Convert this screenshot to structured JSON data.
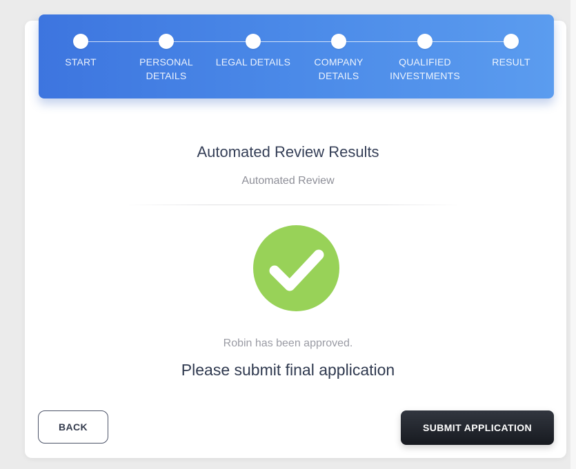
{
  "wizard": {
    "steps": [
      {
        "label": "START"
      },
      {
        "label": "PERSONAL\nDETAILS"
      },
      {
        "label": "LEGAL DETAILS"
      },
      {
        "label": "COMPANY\nDETAILS"
      },
      {
        "label": "QUALIFIED\nINVESTMENTS"
      },
      {
        "label": "RESULT"
      }
    ]
  },
  "review": {
    "title": "Automated Review Results",
    "subtitle": "Automated Review",
    "status_text": "Robin has been approved.",
    "cta_text": "Please submit final application"
  },
  "actions": {
    "back_label": "BACK",
    "submit_label": "SUBMIT APPLICATION"
  },
  "colors": {
    "header_start": "#3d75df",
    "header_end": "#5b9cef",
    "success": "#98d258",
    "submit_button": "#1d2027"
  },
  "icons": {
    "success": "checkmark-circle-icon"
  }
}
